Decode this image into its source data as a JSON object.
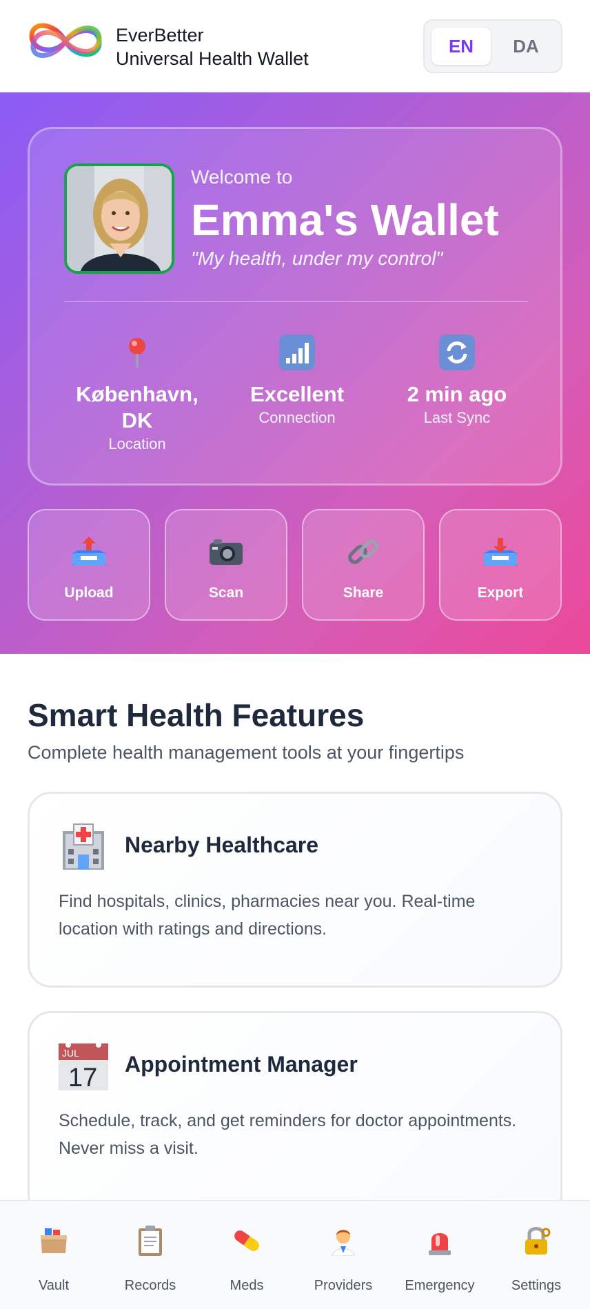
{
  "header": {
    "brand_name": "EverBetter",
    "brand_sub": "Universal Health Wallet",
    "languages": [
      {
        "code": "EN",
        "active": true
      },
      {
        "code": "DA",
        "active": false
      }
    ]
  },
  "hero": {
    "welcome_to": "Welcome to",
    "wallet_name": "Emma's Wallet",
    "tagline": "\"My health, under my control\"",
    "stats": [
      {
        "icon": "pin-icon",
        "value": "København, DK",
        "label": "Location"
      },
      {
        "icon": "signal-icon",
        "value": "Excellent",
        "label": "Connection"
      },
      {
        "icon": "sync-icon",
        "value": "2 min ago",
        "label": "Last Sync"
      }
    ],
    "actions": [
      {
        "icon": "upload-tray-icon",
        "label": "Upload"
      },
      {
        "icon": "camera-icon",
        "label": "Scan"
      },
      {
        "icon": "link-icon",
        "label": "Share"
      },
      {
        "icon": "export-tray-icon",
        "label": "Export"
      }
    ]
  },
  "features": {
    "title": "Smart Health Features",
    "subtitle": "Complete health management tools at your fingertips",
    "cards": [
      {
        "icon": "hospital-icon",
        "title": "Nearby Healthcare",
        "description": "Find hospitals, clinics, pharmacies near you. Real-time location with ratings and directions."
      },
      {
        "icon": "calendar-icon",
        "title": "Appointment Manager",
        "description": "Schedule, track, and get reminders for doctor appointments. Never miss a visit.",
        "calendar_month": "JUL",
        "calendar_day": "17"
      }
    ]
  },
  "bottom_nav": [
    {
      "icon": "vault-box-icon",
      "label": "Vault"
    },
    {
      "icon": "clipboard-icon",
      "label": "Records"
    },
    {
      "icon": "pill-icon",
      "label": "Meds"
    },
    {
      "icon": "doctor-icon",
      "label": "Providers"
    },
    {
      "icon": "siren-icon",
      "label": "Emergency"
    },
    {
      "icon": "lock-icon",
      "label": "Settings"
    }
  ],
  "colors": {
    "accent": "#7c3aed",
    "hero_start": "#8b5cf6",
    "hero_end": "#ec4899",
    "avatar_border": "#16a34a"
  }
}
